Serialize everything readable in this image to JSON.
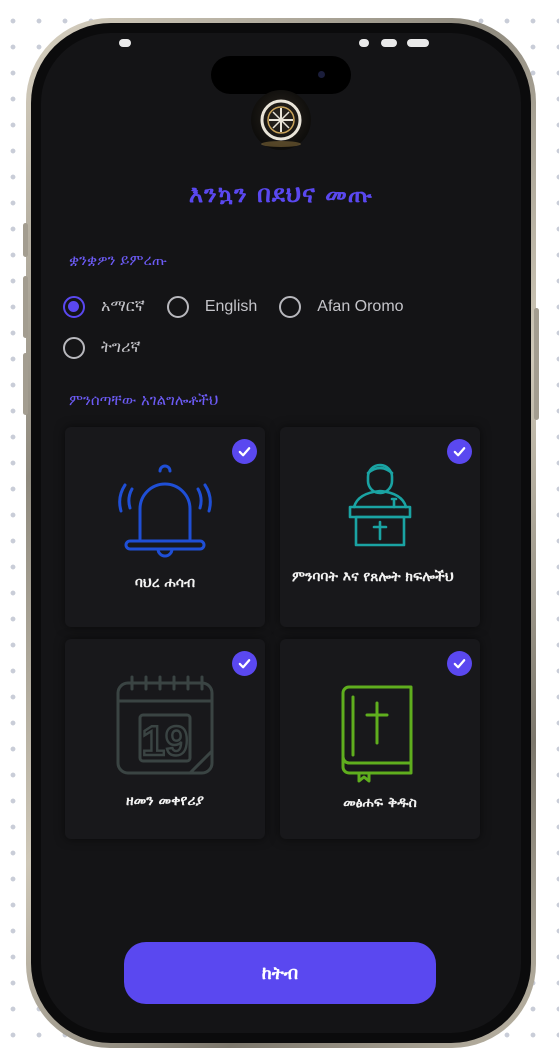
{
  "welcome_title": "እንኳን በደህና መጡ",
  "language_section": {
    "label": "ቋንቋዎን ይምረጡ",
    "options": [
      {
        "label": "አማርኛ",
        "selected": true
      },
      {
        "label": "English",
        "selected": false
      },
      {
        "label": "Afan Oromo",
        "selected": false
      },
      {
        "label": "ትግሪኛ",
        "selected": false
      }
    ]
  },
  "services_section": {
    "label": "ምንሰጣቸው አገልግሎቶችህ",
    "cards": [
      {
        "title": "ባህረ ሐሳብ",
        "icon": "bell-icon",
        "icon_color": "#1f4fd6",
        "checked": true
      },
      {
        "title": "ምንባባት እና የጸሎት ክፍሎችህ",
        "icon": "preacher-podium-icon",
        "icon_color": "#1aa3a3",
        "checked": true
      },
      {
        "title": "ዘመን መቀየሪያ",
        "icon": "calendar-icon",
        "icon_color": "#3a4443",
        "calendar_day": "19",
        "checked": true
      },
      {
        "title": "መፅሐፍ ቅዱስ",
        "icon": "bible-icon",
        "icon_color": "#5fae1e",
        "checked": true
      }
    ]
  },
  "cta_button": "ከትብ",
  "colors": {
    "accent": "#5a48f0",
    "background": "#141416",
    "card": "#18181b"
  }
}
